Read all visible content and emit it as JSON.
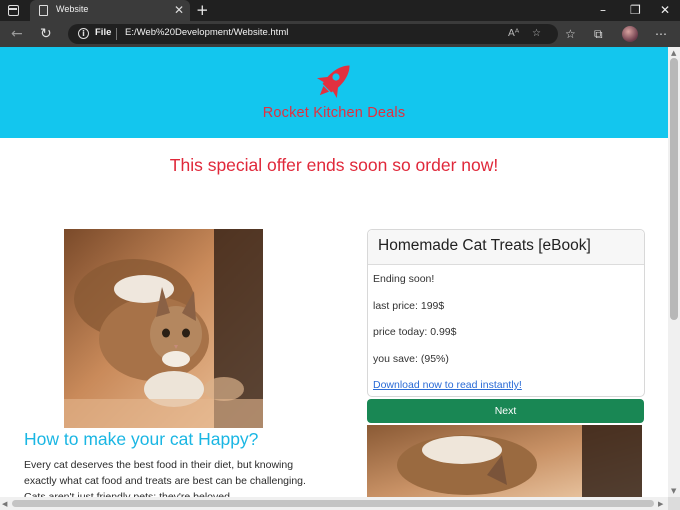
{
  "browser": {
    "tab_title": "Website",
    "new_tab": "+",
    "address_scheme": "File",
    "address_url": "E:/Web%20Development/Website.html",
    "icons": [
      "window-icon",
      "page-favicon-icon",
      "back-arrow-icon",
      "reload-icon",
      "info-icon",
      "read-aloud-icon",
      "add-favorite-icon",
      "favorites-icon",
      "collections-icon",
      "profile-avatar",
      "more-menu-icon"
    ]
  },
  "hero": {
    "logo": "rocket-icon",
    "brand": "Rocket Kitchen Deals",
    "background": "#13c6ee",
    "brand_color": "#e2303f"
  },
  "offer": {
    "text": "This special offer ends soon so order now!"
  },
  "article": {
    "title": "How to make your cat Happy?",
    "body": "Every cat deserves the best food in their diet, but knowing exactly what cat food and treats are best can be challenging. Cats aren't just friendly pets; they're beloved"
  },
  "card": {
    "title": "Homemade Cat Treats [eBook]",
    "status": "Ending soon!",
    "last_price": "last price: 199$",
    "price_today": "price today: 0.99$",
    "savings": "you save: (95%)",
    "link": "Download now to read instantly!",
    "button": "Next",
    "button_color": "#198754"
  }
}
